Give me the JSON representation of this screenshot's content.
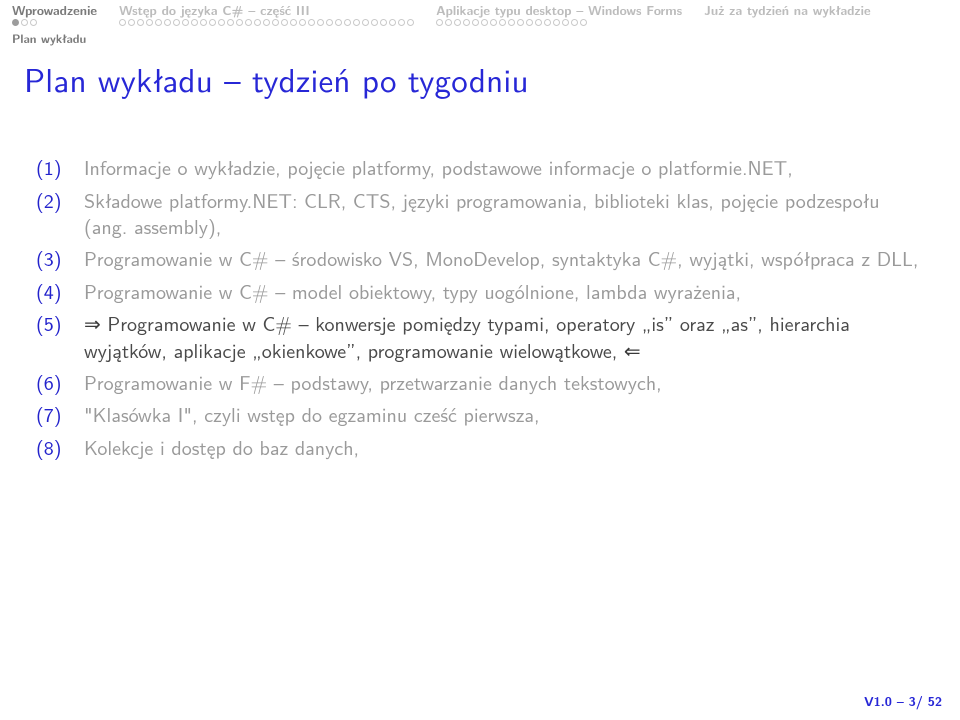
{
  "nav": {
    "items": [
      {
        "label": "Wprowadzenie",
        "active": true,
        "dots_total": 3,
        "dots_filled": 1
      },
      {
        "label": "Wstęp do języka C# – część III",
        "active": false,
        "dots_total": 33,
        "dots_filled": 0
      },
      {
        "label": "Aplikacje typu desktop – Windows Forms",
        "active": false,
        "dots_total": 17,
        "dots_filled": 0
      },
      {
        "label": "Już za tydzień na wykładzie",
        "active": false,
        "dots_total": 0,
        "dots_filled": 0
      }
    ],
    "subsection": "Plan wykładu"
  },
  "title": "Plan wykładu – tydzień po tygodniu",
  "items": [
    {
      "text": "Informacje o wykładzie, pojęcie platformy, podstawowe informacje o platformie.NET,",
      "current": false,
      "prefix": "",
      "suffix": ""
    },
    {
      "text": "Składowe platformy.NET: CLR, CTS, języki programowania, biblioteki klas, pojęcie podzespołu (ang. assembly),",
      "current": false,
      "prefix": "",
      "suffix": ""
    },
    {
      "text": "Programowanie w C# – środowisko VS, MonoDevelop, syntaktyka C#, wyjątki, współpraca z DLL,",
      "current": false,
      "prefix": "",
      "suffix": ""
    },
    {
      "text": "Programowanie w C# – model obiektowy, typy uogólnione, lambda wyrażenia,",
      "current": false,
      "prefix": "",
      "suffix": ""
    },
    {
      "text": "Programowanie w C# – konwersje pomiędzy typami, operatory „is” oraz „as”, hierarchia wyjątków, aplikacje „okienkowe”, programowanie wielowątkowe,",
      "current": true,
      "prefix": "⇒ ",
      "suffix": " ⇐"
    },
    {
      "text": "Programowanie w F# – podstawy, przetwarzanie danych tekstowych,",
      "current": false,
      "prefix": "",
      "suffix": ""
    },
    {
      "text": "\"Klasówka I\", czyli wstęp do egzaminu cześć pierwsza,",
      "current": false,
      "prefix": "",
      "suffix": ""
    },
    {
      "text": "Kolekcje i dostęp do baz danych,",
      "current": false,
      "prefix": "",
      "suffix": ""
    }
  ],
  "footer": "V1.0 – 3/ 52"
}
